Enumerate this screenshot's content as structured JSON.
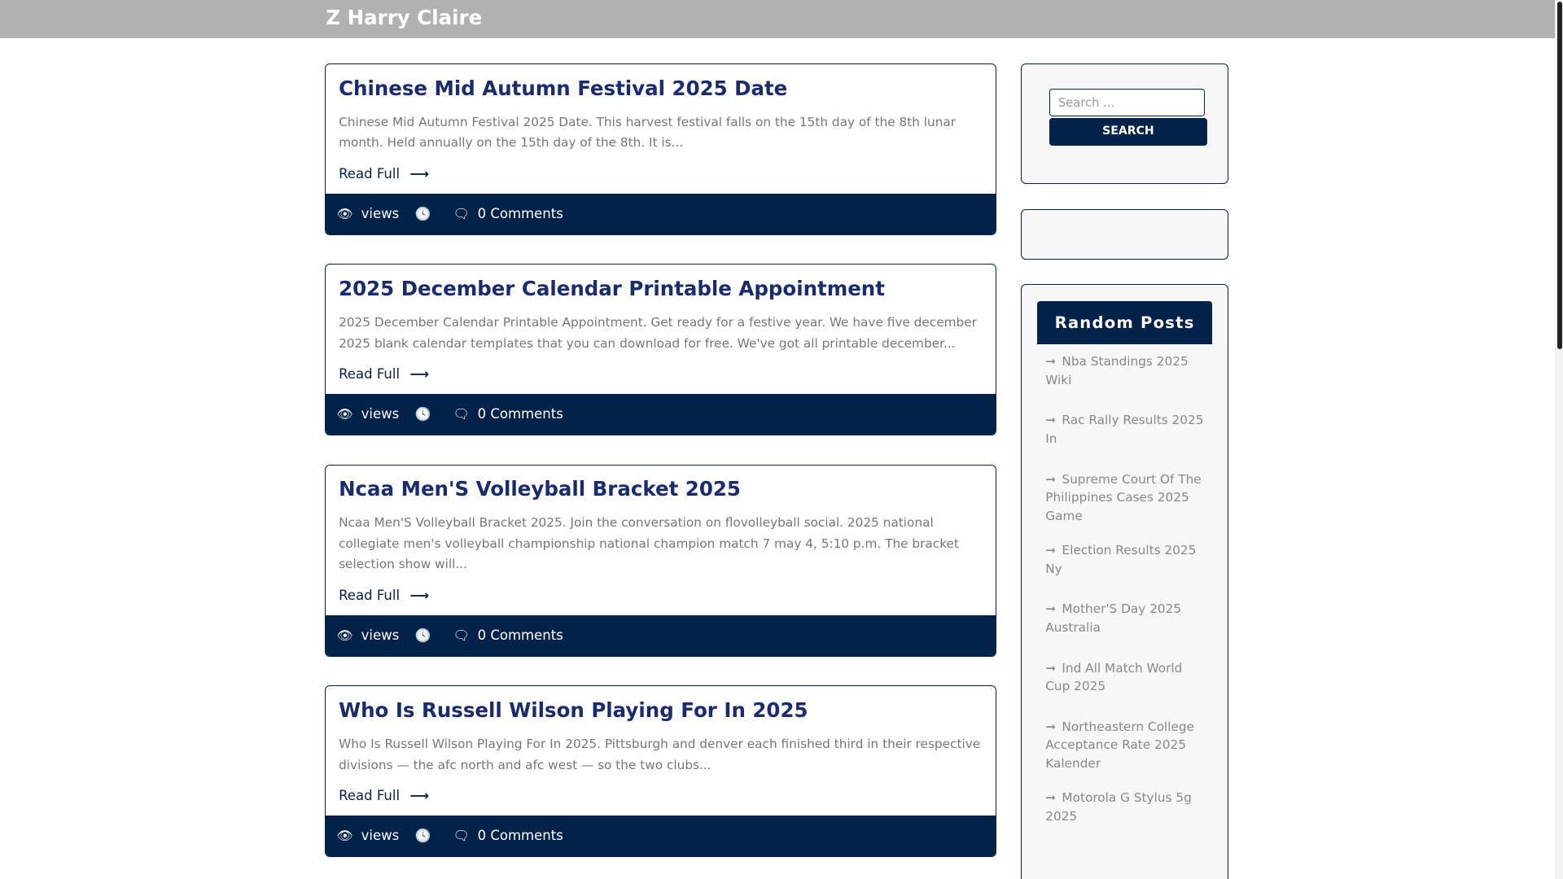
{
  "site_title": "Z Harry Claire",
  "posts": [
    {
      "title": "Chinese Mid Autumn Festival 2025 Date",
      "excerpt": "Chinese Mid Autumn Festival 2025 Date. This harvest festival falls on the 15th day of the 8th lunar month. Held annually on the 15th day of the 8th. It is...",
      "read_more": "Read Full",
      "views": "views",
      "comments": "0 Comments"
    },
    {
      "title": "2025 December Calendar Printable Appointment",
      "excerpt": "2025 December Calendar Printable Appointment. Get ready for a festive year. We have five december 2025 blank calendar templates that you can download for free. We've got all printable december...",
      "read_more": "Read Full",
      "views": "views",
      "comments": "0 Comments"
    },
    {
      "title": "Ncaa Men'S Volleyball Bracket 2025",
      "excerpt": "Ncaa Men'S Volleyball Bracket 2025. Join the conversation on flovolleyball social. 2025 national collegiate men's volleyball championship national champion match 7 may 4, 5:10 p.m. The bracket selection show will...",
      "read_more": "Read Full",
      "views": "views",
      "comments": "0 Comments"
    },
    {
      "title": "Who Is Russell Wilson Playing For In 2025",
      "excerpt": "Who Is Russell Wilson Playing For In 2025. Pittsburgh and denver each finished third in their respective divisions — the afc north and afc west — so the two clubs...",
      "read_more": "Read Full",
      "views": "views",
      "comments": "0 Comments"
    }
  ],
  "search": {
    "placeholder": "Search ...",
    "button": "SEARCH"
  },
  "random_posts": {
    "heading": "Random Posts",
    "items": [
      "Nba Standings 2025 Wiki",
      "Rac Rally Results 2025 In",
      "Supreme Court Of The Philippines Cases 2025 Game",
      "Election Results 2025 Ny",
      "Mother'S Day 2025 Australia",
      "Ind All Match World Cup 2025",
      "Northeastern College Acceptance Rate 2025 Kalender",
      "Motorola G Stylus 5g 2025"
    ]
  },
  "colors": {
    "primary": "#022249",
    "header": "#b1b1b1",
    "title": "#1a2c6b"
  }
}
